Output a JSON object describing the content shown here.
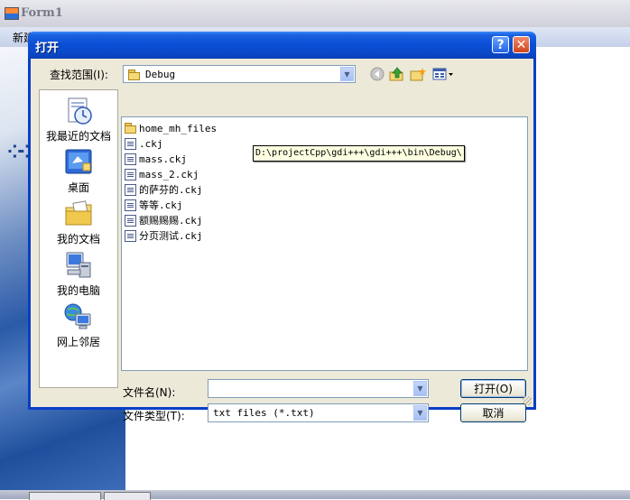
{
  "background_window": {
    "title": "Form1",
    "menu_item": "新建"
  },
  "dialog": {
    "title": "打开",
    "help_glyph": "?",
    "close_glyph": "✕",
    "look_in_label": "查找范围(I):",
    "look_in_value": "Debug",
    "path_tooltip": "D:\\projectCpp\\gdi+++\\gdi+++\\bin\\Debug\\",
    "toolbar_icons": [
      "back-icon",
      "up-folder-icon",
      "new-folder-icon",
      "views-menu-icon"
    ],
    "places": [
      {
        "label": "我最近的文档",
        "icon": "recent-documents-icon"
      },
      {
        "label": "桌面",
        "icon": "desktop-icon"
      },
      {
        "label": "我的文档",
        "icon": "my-documents-icon"
      },
      {
        "label": "我的电脑",
        "icon": "my-computer-icon"
      },
      {
        "label": "网上邻居",
        "icon": "network-places-icon"
      }
    ],
    "files": [
      {
        "name": "home_mh_files",
        "type": "folder"
      },
      {
        "name": ".ckj",
        "type": "file"
      },
      {
        "name": "mass.ckj",
        "type": "file"
      },
      {
        "name": "mass_2.ckj",
        "type": "file"
      },
      {
        "name": "的萨芬的.ckj",
        "type": "file"
      },
      {
        "name": "等等.ckj",
        "type": "file"
      },
      {
        "name": "额赐赐赐.ckj",
        "type": "file"
      },
      {
        "name": "分页测试.ckj",
        "type": "file"
      }
    ],
    "file_name_label": "文件名(N):",
    "file_name_value": "",
    "file_type_label": "文件类型(T):",
    "file_type_value": "txt files (*.txt)",
    "open_button": "打开(O)",
    "cancel_button": "取消"
  },
  "colors": {
    "titlebar_blue": "#0a49c8",
    "dialog_face": "#ece9d8",
    "tooltip_bg": "#ffffe1"
  }
}
